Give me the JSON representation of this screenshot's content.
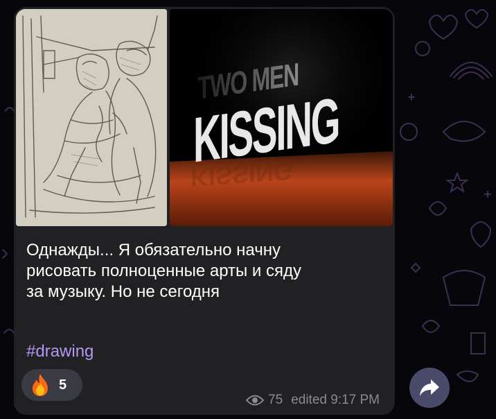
{
  "message": {
    "caption": "Однажды... Я обязательно начну\nрисовать полноценные арты и сяду\nза музыку. Но не сегодня",
    "hashtag": "#drawing",
    "reaction": {
      "emoji_icon": "fire-emoji-icon",
      "count": "5"
    },
    "views": "75",
    "edited_time": "edited 9:17 PM",
    "images": [
      {
        "name": "pencil-sketch-image"
      },
      {
        "name": "two-men-kissing-image",
        "text": [
          "TWO MEN",
          "KISSING"
        ]
      }
    ]
  },
  "colors": {
    "background": "#07060b",
    "bubble": "#212123",
    "hashtag": "#b695f4",
    "meta": "#8b8b90",
    "share_button": "#4a4a6a"
  }
}
